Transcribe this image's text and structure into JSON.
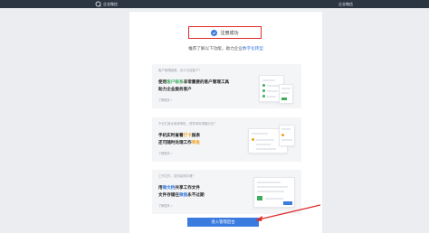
{
  "topbar": {
    "brand": "企业微信",
    "right_link": "企业微信"
  },
  "success": {
    "label": "注册成功"
  },
  "subtitle": {
    "prefix": "推荐了解以下功能，助力企业",
    "accent": "数字化转型"
  },
  "cards": [
    {
      "question": "客户管理困难，怎么沉淀客户？",
      "line1_a": "使用",
      "line1_hl": "客户联系",
      "line1_b": "非常重要的客户管理工具",
      "line2": "助力企业服务客户",
      "more": "了解更多 >"
    },
    {
      "question": "不记汇报太麻烦审批，领导审批再跑出去？",
      "line1_a": "手机实时查看",
      "line1_hl": "打卡",
      "line1_b": "报表",
      "line2_a": "还可随时处理工作",
      "line2_hl": "审批",
      "more": "了解更多 >"
    },
    {
      "question": "工作文件，如何高效存储？",
      "line1_a": "用",
      "line1_hl": "微文档",
      "line1_b": "共享工作文件",
      "line2_a": "文件存储在",
      "line2_hl": "微盘",
      "line2_b": "永不过期",
      "more": "了解更多 >"
    }
  ],
  "cta": {
    "label": "进入管理后台"
  },
  "colors": {
    "accent_blue": "#3a7be0",
    "highlight_red": "#e02a2a",
    "green": "#3cae5c",
    "orange": "#f0a020"
  }
}
